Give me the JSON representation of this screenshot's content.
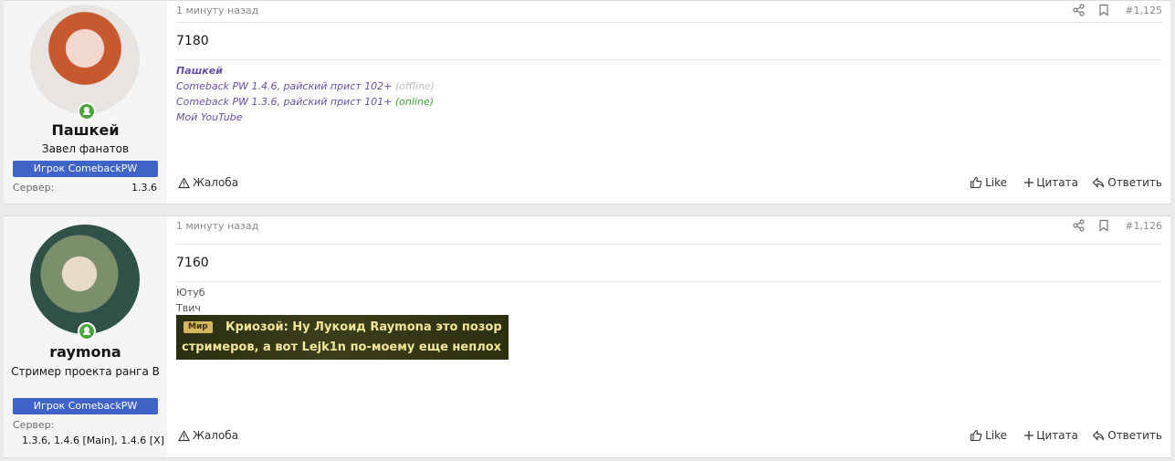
{
  "posts": [
    {
      "user": {
        "name": "Пашкей",
        "title": "Завел фанатов",
        "banner": "Игрок ComebackPW",
        "server_label": "Сервер:",
        "server_value": "1.3.6"
      },
      "time": "1 минуту назад",
      "number": "#1,125",
      "content": "7180",
      "signature": {
        "name": "Пашкей",
        "line1": "Comeback PW 1.4.6, райский прист 102+",
        "line1_status": "(offline)",
        "line2": "Comeback PW 1.3.6, райский прист 101+",
        "line2_status": "(online)",
        "line3": "Мой YouTube"
      },
      "actions": {
        "report": "Жалоба",
        "like": "Like",
        "quote": "Цитата",
        "reply": "Ответить"
      }
    },
    {
      "user": {
        "name": "raymona",
        "title": "Стример проекта ранга B",
        "banner": "Игрок ComebackPW",
        "server_label": "Сервер:",
        "server_value": "1.3.6, 1.4.6 [Main], 1.4.6 [X]"
      },
      "time": "1 минуту назад",
      "number": "#1,126",
      "content": "7160",
      "signature": {
        "line1": "Ютуб",
        "line2": "Твич",
        "image_tag": "Мир",
        "image_line1": "Криозой: Ну Лукоид Raymona это позор",
        "image_line2": "стримеров, а вот Lejk1n по-моему еще неплох"
      },
      "actions": {
        "report": "Жалоба",
        "like": "Like",
        "quote": "Цитата",
        "reply": "Ответить"
      }
    }
  ],
  "icons": [
    "share-icon",
    "bookmark-icon",
    "warning-icon",
    "thumbs-up-icon",
    "plus-icon",
    "reply-icon"
  ]
}
